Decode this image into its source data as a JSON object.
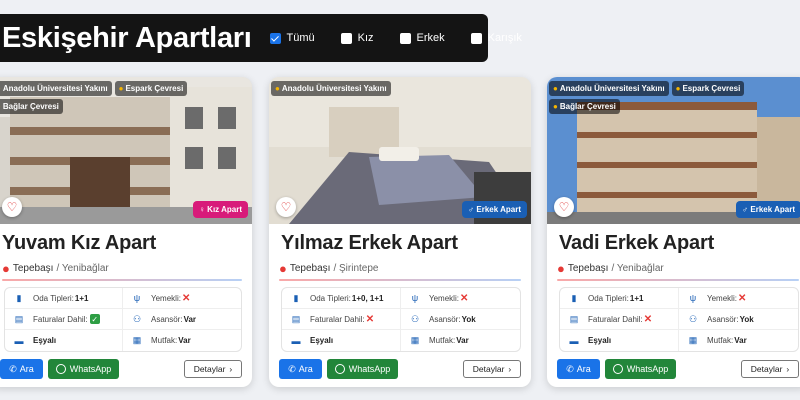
{
  "header": {
    "title": "Eskişehir Apartları",
    "filters": [
      {
        "label": "Tümü",
        "checked": true
      },
      {
        "label": "Kız",
        "checked": false
      },
      {
        "label": "Erkek",
        "checked": false
      },
      {
        "label": "Karışık",
        "checked": false
      }
    ]
  },
  "cards": [
    {
      "tags": [
        "Anadolu Üniversitesi Yakını",
        "Espark Çevresi",
        "Bağlar Çevresi"
      ],
      "gender_label": "Kız Apart",
      "gender_icon": "female-icon",
      "name": "Yuvam Kız Apart",
      "district": "Tepebaşı",
      "neighborhood": "/ Yenibağlar",
      "room_label": "Oda Tipleri:",
      "room_value": "1+1",
      "meal_label": "Yemekli:",
      "meal_value": "no",
      "bills_label": "Faturalar Dahil:",
      "bills_value": "yes",
      "elevator_label": "Asansör:",
      "elevator_value": "Var",
      "furnished_label": "Eşyalı",
      "kitchen_label": "Mutfak:",
      "kitchen_value": "Var",
      "call_label": "Ara",
      "whatsapp_label": "WhatsApp",
      "details_label": "Detaylar"
    },
    {
      "tags": [
        "Anadolu Üniversitesi Yakını"
      ],
      "gender_label": "Erkek Apart",
      "gender_icon": "male-icon",
      "name": "Yılmaz Erkek Apart",
      "district": "Tepebaşı",
      "neighborhood": "/ Şirintepe",
      "room_label": "Oda Tipleri:",
      "room_value": "1+0, 1+1",
      "meal_label": "Yemekli:",
      "meal_value": "no",
      "bills_label": "Faturalar Dahil:",
      "bills_value": "no",
      "elevator_label": "Asansör:",
      "elevator_value": "Yok",
      "furnished_label": "Eşyalı",
      "kitchen_label": "Mutfak:",
      "kitchen_value": "Var",
      "call_label": "Ara",
      "whatsapp_label": "WhatsApp",
      "details_label": "Detaylar"
    },
    {
      "tags": [
        "Anadolu Üniversitesi Yakını",
        "Espark Çevresi",
        "Bağlar Çevresi"
      ],
      "gender_label": "Erkek Apart",
      "gender_icon": "male-icon",
      "name": "Vadi Erkek Apart",
      "district": "Tepebaşı",
      "neighborhood": "/ Yenibağlar",
      "room_label": "Oda Tipleri:",
      "room_value": "1+1",
      "meal_label": "Yemekli:",
      "meal_value": "no",
      "bills_label": "Faturalar Dahil:",
      "bills_value": "no",
      "elevator_label": "Asansör:",
      "elevator_value": "Yok",
      "furnished_label": "Eşyalı",
      "kitchen_label": "Mutfak:",
      "kitchen_value": "Var",
      "call_label": "Ara",
      "whatsapp_label": "WhatsApp",
      "details_label": "Detaylar"
    }
  ],
  "colors": {
    "header_bg": "#141414",
    "accent_blue": "#1a73e8",
    "whatsapp_green": "#22863a",
    "female_badge": "#d81b7a",
    "male_badge": "#1a5fb4"
  }
}
